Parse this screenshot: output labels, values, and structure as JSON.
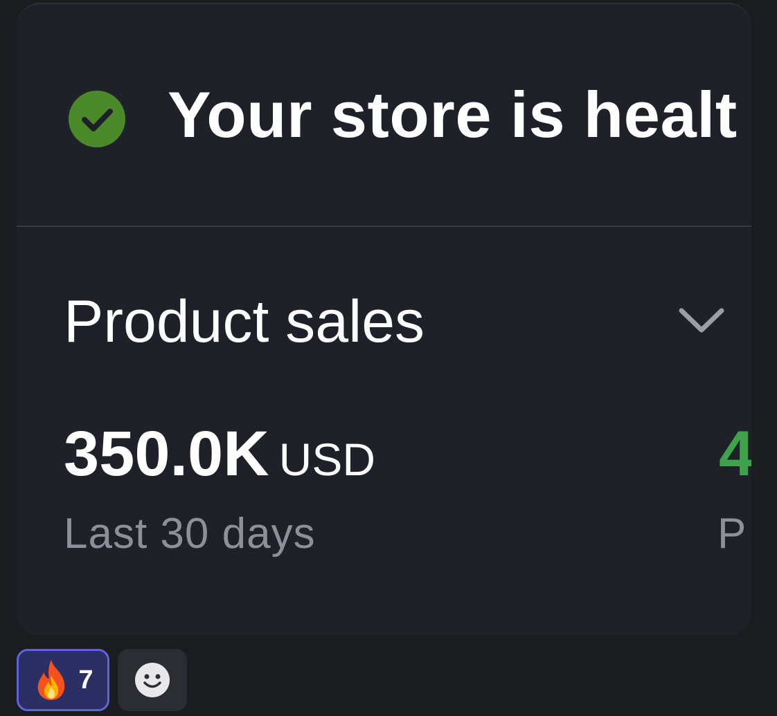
{
  "card": {
    "health": {
      "title": "Your store is healt",
      "icon": "check-circle-icon",
      "icon_color": "#4a8a2a"
    },
    "sales": {
      "title": "Product sales",
      "expand_icon": "chevron-down-icon",
      "metric": {
        "value": "350.0K",
        "unit": "USD",
        "period": "Last 30 days"
      },
      "metric2": {
        "value": "4",
        "label": "P",
        "color": "#3fa34d"
      }
    }
  },
  "reactions": {
    "items": [
      {
        "emoji": "🔥",
        "icon": "fire-icon",
        "count": "7"
      }
    ],
    "add_icon": "smiley-add-icon"
  }
}
